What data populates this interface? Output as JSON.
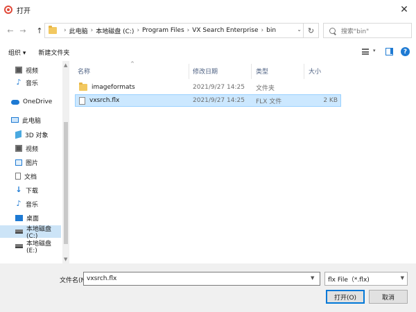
{
  "window": {
    "title": "打开",
    "close_glyph": "✕"
  },
  "nav": {
    "back_glyph": "←",
    "forward_glyph": "→",
    "up_glyph": "↑"
  },
  "address": {
    "breadcrumbs": [
      "此电脑",
      "本地磁盘 (C:)",
      "Program Files",
      "VX Search Enterprise",
      "bin"
    ],
    "separator": "›",
    "dropdown_glyph": "⌄",
    "refresh_glyph": "↻"
  },
  "search": {
    "placeholder": "搜索\"bin\""
  },
  "toolbar": {
    "organize": "组织 ▾",
    "new_folder": "新建文件夹",
    "view_drop": "▾",
    "help_glyph": "?"
  },
  "sidebar": {
    "items": [
      {
        "label": "视频",
        "icon": "video-icon"
      },
      {
        "label": "音乐",
        "icon": "music-icon"
      },
      {
        "label": "OneDrive",
        "icon": "cloud-icon"
      },
      {
        "label": "此电脑",
        "icon": "computer-icon"
      },
      {
        "label": "3D 对象",
        "icon": "3d-objects-icon"
      },
      {
        "label": "视频",
        "icon": "video-icon"
      },
      {
        "label": "图片",
        "icon": "pictures-icon"
      },
      {
        "label": "文档",
        "icon": "documents-icon"
      },
      {
        "label": "下载",
        "icon": "download-icon"
      },
      {
        "label": "音乐",
        "icon": "music-icon"
      },
      {
        "label": "桌面",
        "icon": "desktop-icon"
      },
      {
        "label": "本地磁盘 (C:)",
        "icon": "drive-icon",
        "selected": true
      },
      {
        "label": "本地磁盘 (E:)",
        "icon": "drive-icon"
      }
    ]
  },
  "filelist": {
    "columns": {
      "name": "名称",
      "date": "修改日期",
      "type": "类型",
      "size": "大小"
    },
    "sort_glyph": "^",
    "rows": [
      {
        "name": "imageformats",
        "date": "2021/9/27 14:25",
        "type": "文件夹",
        "size": "",
        "kind": "folder"
      },
      {
        "name": "vxsrch.flx",
        "date": "2021/9/27 14:25",
        "type": "FLX 文件",
        "size": "2 KB",
        "kind": "file",
        "selected": true
      }
    ]
  },
  "footer": {
    "filename_label": "文件名(N):",
    "filename_value": "vxsrch.flx",
    "filetype_value": "flx File（*.flx)",
    "open_button": "打开(O)",
    "cancel_button": "取消"
  }
}
